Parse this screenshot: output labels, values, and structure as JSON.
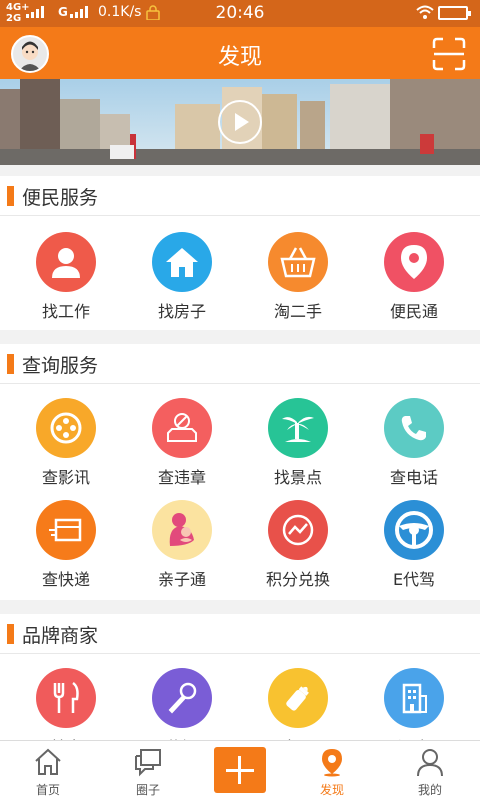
{
  "status_bar": {
    "network_top": "4G+",
    "network_bottom": "2G",
    "carrier2": "G",
    "speed": "0.1K/s",
    "time": "20:46"
  },
  "header": {
    "title": "发现",
    "avatar_icon": "user-avatar",
    "scan_icon": "scan-icon"
  },
  "banner": {
    "play_icon": "play-icon"
  },
  "sections": [
    {
      "title": "便民服务",
      "items": [
        {
          "label": "找工作",
          "icon": "person-icon",
          "color": "#ef5a4a"
        },
        {
          "label": "找房子",
          "icon": "house-icon",
          "color": "#29a8e8"
        },
        {
          "label": "淘二手",
          "icon": "basket-icon",
          "color": "#f68a2e"
        },
        {
          "label": "便民通",
          "icon": "location-pin-icon",
          "color": "#f05164"
        }
      ]
    },
    {
      "title": "查询服务",
      "items": [
        {
          "label": "查影讯",
          "icon": "film-reel-icon",
          "color": "#f8a829"
        },
        {
          "label": "查违章",
          "icon": "car-violation-icon",
          "color": "#f45f5f"
        },
        {
          "label": "找景点",
          "icon": "palm-tree-icon",
          "color": "#27c496"
        },
        {
          "label": "查电话",
          "icon": "phone-icon",
          "color": "#5ccbc4"
        },
        {
          "label": "查快递",
          "icon": "delivery-box-icon",
          "color": "#f67b1a"
        },
        {
          "label": "亲子通",
          "icon": "parent-child-icon",
          "color": "#fbe3a0"
        },
        {
          "label": "积分兑换",
          "icon": "points-exchange-icon",
          "color": "#e8514a"
        },
        {
          "label": "E代驾",
          "icon": "steering-wheel-icon",
          "color": "#2b8fd6"
        }
      ]
    },
    {
      "title": "品牌商家",
      "items": [
        {
          "label": "美食",
          "icon": "fork-knife-icon",
          "color": "#f05b5b"
        },
        {
          "label": "休闲",
          "icon": "microphone-icon",
          "color": "#7a5dd6"
        },
        {
          "label": "亲子",
          "icon": "baby-bottle-icon",
          "color": "#f8c230"
        },
        {
          "label": "酒店",
          "icon": "building-icon",
          "color": "#4aa3ea"
        }
      ]
    }
  ],
  "tab_bar": [
    {
      "label": "首页",
      "icon": "home-icon"
    },
    {
      "label": "圈子",
      "icon": "chat-icon"
    },
    {
      "label": "",
      "icon": "plus-icon"
    },
    {
      "label": "发现",
      "icon": "discover-pin-icon"
    },
    {
      "label": "我的",
      "icon": "person-outline-icon"
    }
  ]
}
